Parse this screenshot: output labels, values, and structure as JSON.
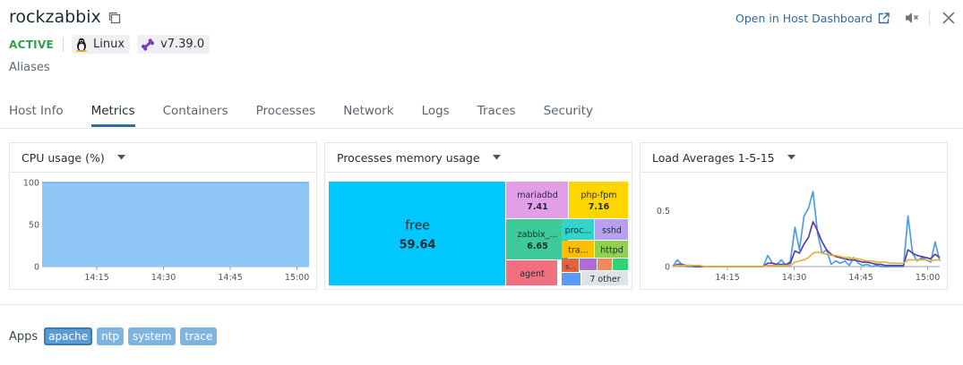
{
  "host": {
    "name": "rockzabbix",
    "status": "ACTIVE",
    "os": "Linux",
    "agent_version": "v7.39.0",
    "aliases_label": "Aliases"
  },
  "header": {
    "open_dashboard_label": "Open in Host Dashboard",
    "icons": [
      "external-link-icon",
      "mute-icon",
      "close-icon"
    ]
  },
  "tabs": [
    {
      "label": "Host Info",
      "active": false
    },
    {
      "label": "Metrics",
      "active": true
    },
    {
      "label": "Containers",
      "active": false
    },
    {
      "label": "Processes",
      "active": false
    },
    {
      "label": "Network",
      "active": false
    },
    {
      "label": "Logs",
      "active": false
    },
    {
      "label": "Traces",
      "active": false
    },
    {
      "label": "Security",
      "active": false
    }
  ],
  "colors": {
    "accent": "#2f6aa8",
    "active_status": "#2fa14b",
    "cpu_fill": "#8fc7f7",
    "load_1": "#4a9ee8",
    "load_5": "#5b3fa8",
    "load_15": "#e8b23a"
  },
  "cards": {
    "cpu": {
      "title": "CPU usage (%)"
    },
    "memory": {
      "title": "Processes memory usage"
    },
    "load": {
      "title": "Load Averages 1-5-15"
    }
  },
  "chart_data": [
    {
      "type": "area",
      "x_ticks": [
        "14:15",
        "14:30",
        "14:45",
        "15:00"
      ],
      "y_ticks": [
        "0",
        "50",
        "100"
      ],
      "ylim": [
        0,
        100
      ],
      "series": [
        {
          "values": [
            100,
            100,
            100,
            100,
            100,
            100,
            100,
            100,
            100,
            100,
            100,
            100,
            100,
            100,
            100,
            100,
            100,
            100,
            100,
            100,
            100,
            100,
            100,
            100,
            100,
            100,
            100,
            100,
            100,
            100,
            100,
            100,
            100,
            100,
            100,
            100,
            100,
            100,
            100,
            100,
            100,
            100,
            100,
            100,
            100,
            100,
            100,
            100,
            100,
            100,
            100,
            100,
            100,
            100,
            100,
            100,
            100,
            100,
            100,
            100
          ]
        }
      ]
    },
    {
      "type": "treemap",
      "items": [
        {
          "label": "free",
          "value": "59.64",
          "color": "#00c8ff"
        },
        {
          "label": "mariadbd",
          "value": "7.41",
          "color": "#e39ee8"
        },
        {
          "label": "php-fpm",
          "value": "7.16",
          "color": "#ffd500"
        },
        {
          "label": "zabbix_...",
          "value": "6.65",
          "color": "#3ec99a"
        },
        {
          "label": "agent",
          "value": "",
          "color": "#f0707f"
        },
        {
          "label": "proc...",
          "value": "",
          "color": "#2fd6c9"
        },
        {
          "label": "sshd",
          "value": "",
          "color": "#b8a0f0"
        },
        {
          "label": "tra...",
          "value": "",
          "color": "#ffbf00"
        },
        {
          "label": "httpd",
          "value": "",
          "color": "#8fd14f"
        },
        {
          "label": "s...",
          "value": "",
          "color": "#e8603c"
        },
        {
          "label": "",
          "value": "",
          "color": "#b06bd9"
        },
        {
          "label": "",
          "value": "",
          "color": "#f08a5d"
        },
        {
          "label": "",
          "value": "",
          "color": "#2ed573"
        },
        {
          "label": "",
          "value": "",
          "color": "#5b9bf8"
        },
        {
          "label": "7 other",
          "value": "",
          "color": "#dfe3e8"
        }
      ]
    },
    {
      "type": "line",
      "x_ticks": [
        "14:15",
        "14:30",
        "14:45",
        "15:00"
      ],
      "y_ticks": [
        "0",
        "0.5"
      ],
      "ylim": [
        0,
        0.75
      ],
      "series": [
        {
          "color": "#4a9ee8",
          "values": [
            0,
            0.06,
            0.02,
            0,
            0,
            0,
            0,
            0,
            0,
            0,
            0,
            0,
            0,
            0,
            0,
            0,
            0,
            0,
            0,
            0,
            0,
            0.1,
            0.03,
            0.02,
            0.06,
            0.01,
            0.05,
            0.35,
            0.15,
            0.45,
            0.52,
            0.67,
            0.3,
            0.12,
            0.15,
            0.02,
            0.05,
            0.03,
            0.05,
            0.01,
            0.08,
            0.03,
            0.01,
            0.02,
            0,
            0.01,
            0,
            0,
            0,
            0,
            0,
            0,
            0.45,
            0.12,
            0.05,
            0.08,
            0.06,
            0.04,
            0.22,
            0.05
          ]
        },
        {
          "color": "#5b3fa8",
          "values": [
            0,
            0.02,
            0.02,
            0.01,
            0.01,
            0,
            0,
            0,
            0,
            0,
            0,
            0,
            0,
            0,
            0,
            0,
            0,
            0,
            0,
            0,
            0,
            0.03,
            0.03,
            0.02,
            0.02,
            0.02,
            0.03,
            0.14,
            0.12,
            0.2,
            0.26,
            0.4,
            0.32,
            0.22,
            0.15,
            0.11,
            0.09,
            0.08,
            0.07,
            0.06,
            0.06,
            0.05,
            0.04,
            0.04,
            0.03,
            0.02,
            0.02,
            0.01,
            0.01,
            0.01,
            0.01,
            0.01,
            0.15,
            0.12,
            0.1,
            0.09,
            0.08,
            0.07,
            0.11,
            0.08
          ]
        },
        {
          "color": "#e8b23a",
          "values": [
            0,
            0.01,
            0.01,
            0.01,
            0.01,
            0.01,
            0.01,
            0,
            0,
            0,
            0,
            0,
            0,
            0,
            0,
            0,
            0,
            0,
            0,
            0,
            0,
            0.01,
            0.01,
            0.01,
            0.01,
            0.01,
            0.01,
            0.04,
            0.05,
            0.06,
            0.08,
            0.12,
            0.13,
            0.12,
            0.11,
            0.1,
            0.1,
            0.09,
            0.08,
            0.08,
            0.07,
            0.07,
            0.06,
            0.05,
            0.05,
            0.04,
            0.04,
            0.04,
            0.03,
            0.03,
            0.03,
            0.03,
            0.06,
            0.06,
            0.06,
            0.06,
            0.06,
            0.05,
            0.06,
            0.06
          ]
        }
      ]
    }
  ],
  "apps": {
    "label": "Apps",
    "items": [
      {
        "label": "apache",
        "selected": true
      },
      {
        "label": "ntp",
        "selected": false
      },
      {
        "label": "system",
        "selected": false
      },
      {
        "label": "trace",
        "selected": false
      }
    ]
  }
}
